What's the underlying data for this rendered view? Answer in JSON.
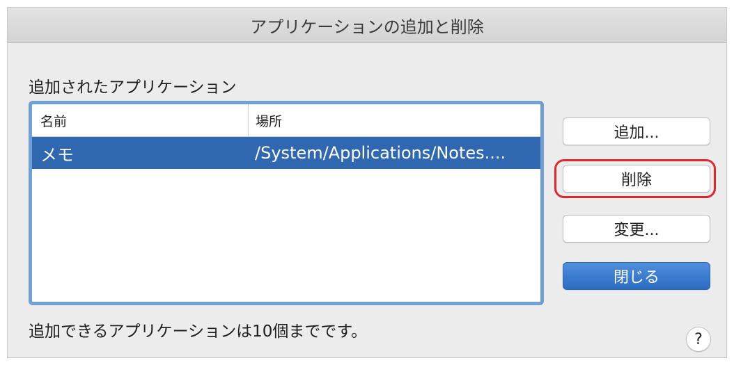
{
  "window": {
    "title": "アプリケーションの追加と削除"
  },
  "section_label": "追加されたアプリケーション",
  "list": {
    "columns": {
      "name": "名前",
      "location": "場所"
    },
    "rows": [
      {
        "name": "メモ",
        "location": "/System/Applications/Notes....",
        "selected": true
      }
    ]
  },
  "buttons": {
    "add": "追加...",
    "delete": "削除",
    "change": "変更...",
    "close": "閉じる"
  },
  "footer_text": "追加できるアプリケーションは10個までです。",
  "help_label": "?",
  "colors": {
    "accent": "#2f67b0",
    "highlight": "#e0262b",
    "list_border": "#6f9fd3"
  }
}
